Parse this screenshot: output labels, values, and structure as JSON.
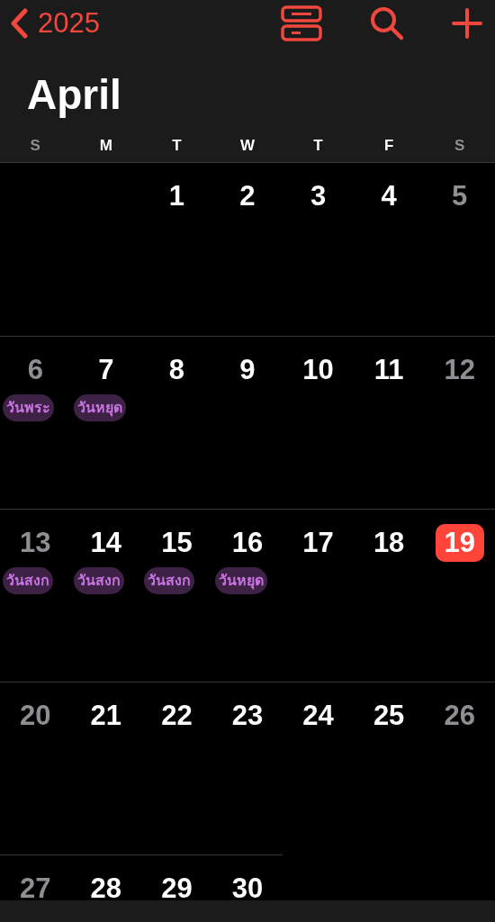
{
  "nav": {
    "back_label": "2025"
  },
  "month_title": "April",
  "weekday_headers": [
    {
      "label": "S",
      "weekend": true
    },
    {
      "label": "M",
      "weekend": false
    },
    {
      "label": "T",
      "weekend": false
    },
    {
      "label": "W",
      "weekend": false
    },
    {
      "label": "T",
      "weekend": false
    },
    {
      "label": "F",
      "weekend": false
    },
    {
      "label": "S",
      "weekend": true
    }
  ],
  "weeks": [
    [
      {
        "kind": "blank"
      },
      {
        "kind": "blank"
      },
      {
        "kind": "day",
        "day": "1",
        "weekend": false,
        "selected": false
      },
      {
        "kind": "day",
        "day": "2",
        "weekend": false,
        "selected": false
      },
      {
        "kind": "day",
        "day": "3",
        "weekend": false,
        "selected": false
      },
      {
        "kind": "day",
        "day": "4",
        "weekend": false,
        "selected": false
      },
      {
        "kind": "day",
        "day": "5",
        "weekend": true,
        "selected": false
      }
    ],
    [
      {
        "kind": "day",
        "day": "6",
        "weekend": true,
        "selected": false,
        "events": [
          "วันพระ"
        ]
      },
      {
        "kind": "day",
        "day": "7",
        "weekend": false,
        "selected": false,
        "events": [
          "วันหยุด"
        ]
      },
      {
        "kind": "day",
        "day": "8",
        "weekend": false,
        "selected": false
      },
      {
        "kind": "day",
        "day": "9",
        "weekend": false,
        "selected": false
      },
      {
        "kind": "day",
        "day": "10",
        "weekend": false,
        "selected": false
      },
      {
        "kind": "day",
        "day": "11",
        "weekend": false,
        "selected": false
      },
      {
        "kind": "day",
        "day": "12",
        "weekend": true,
        "selected": false
      }
    ],
    [
      {
        "kind": "day",
        "day": "13",
        "weekend": true,
        "selected": false,
        "events": [
          "วันสงก"
        ]
      },
      {
        "kind": "day",
        "day": "14",
        "weekend": false,
        "selected": false,
        "events": [
          "วันสงก"
        ]
      },
      {
        "kind": "day",
        "day": "15",
        "weekend": false,
        "selected": false,
        "events": [
          "วันสงก"
        ]
      },
      {
        "kind": "day",
        "day": "16",
        "weekend": false,
        "selected": false,
        "events": [
          "วันหยุด"
        ]
      },
      {
        "kind": "day",
        "day": "17",
        "weekend": false,
        "selected": false
      },
      {
        "kind": "day",
        "day": "18",
        "weekend": false,
        "selected": false
      },
      {
        "kind": "day",
        "day": "19",
        "weekend": true,
        "selected": true
      }
    ],
    [
      {
        "kind": "day",
        "day": "20",
        "weekend": true,
        "selected": false
      },
      {
        "kind": "day",
        "day": "21",
        "weekend": false,
        "selected": false
      },
      {
        "kind": "day",
        "day": "22",
        "weekend": false,
        "selected": false
      },
      {
        "kind": "day",
        "day": "23",
        "weekend": false,
        "selected": false
      },
      {
        "kind": "day",
        "day": "24",
        "weekend": false,
        "selected": false
      },
      {
        "kind": "day",
        "day": "25",
        "weekend": false,
        "selected": false
      },
      {
        "kind": "day",
        "day": "26",
        "weekend": true,
        "selected": false
      }
    ],
    [
      {
        "kind": "day",
        "day": "27",
        "weekend": true,
        "selected": false
      },
      {
        "kind": "day",
        "day": "28",
        "weekend": false,
        "selected": false
      },
      {
        "kind": "day",
        "day": "29",
        "weekend": false,
        "selected": false
      },
      {
        "kind": "day",
        "day": "30",
        "weekend": false,
        "selected": false
      }
    ]
  ]
}
